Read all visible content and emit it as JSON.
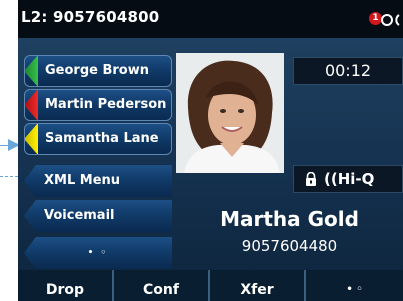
{
  "header": {
    "title": "L2: 9057604800",
    "missed_badge": "1",
    "icon": "phone-status-icon"
  },
  "line_keys": [
    {
      "label": "George Brown",
      "status_color": "#2eb043"
    },
    {
      "label": "Martin Pederson",
      "status_color": "#e02020"
    },
    {
      "label": "Samantha Lane",
      "status_color": "#f3e600"
    }
  ],
  "nav_keys": [
    {
      "label": "XML Menu"
    },
    {
      "label": "Voicemail"
    },
    {
      "label": "• ◦"
    }
  ],
  "call": {
    "timer": "00:12",
    "codec": "((Hi-Q",
    "caller_name": "Martha Gold",
    "caller_number": "9057604480"
  },
  "softkeys": [
    {
      "label": "Drop"
    },
    {
      "label": "Conf"
    },
    {
      "label": "Xfer"
    },
    {
      "label": "• ◦"
    }
  ]
}
